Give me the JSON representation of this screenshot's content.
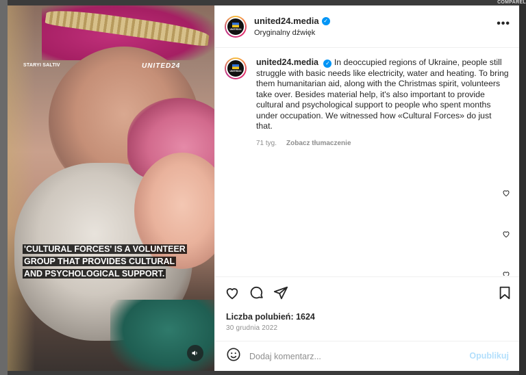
{
  "background": {
    "corner_tag": "COMPAREL"
  },
  "media": {
    "watermark_small": "STARYI SALTIV",
    "watermark_brand": "UNITED24",
    "caption": "'CULTURAL FORCES' IS A VOLUNTEER GROUP THAT PROVIDES CULTURAL AND PSYCHOLOGICAL SUPPORT.",
    "sound_icon": "speaker-icon"
  },
  "header": {
    "username": "united24.media",
    "audio_label": "Oryginalny dźwięk",
    "avatar_text": "UNITED24"
  },
  "post_caption": {
    "username": "united24.media",
    "text": "In deoccupied regions of Ukraine, people still struggle with basic needs like electricity, water and heating. To bring them humanitarian aid, along with the Christmas spirit, volunteers take over. Besides material help, it's also important to provide cultural and psychological support to people who spent months under occupation. We witnessed how «Cultural Forces» do just that.",
    "age": "71 tyg.",
    "see_translation": "Zobacz tłumaczenie"
  },
  "engagement": {
    "likes_label": "Liczba polubień: 1624",
    "date": "30 grudnia 2022"
  },
  "comment": {
    "placeholder": "Dodaj komentarz...",
    "post_label": "Opublikuj"
  },
  "colors": {
    "verified": "#0095f6",
    "post_disabled": "#b2dffc"
  }
}
